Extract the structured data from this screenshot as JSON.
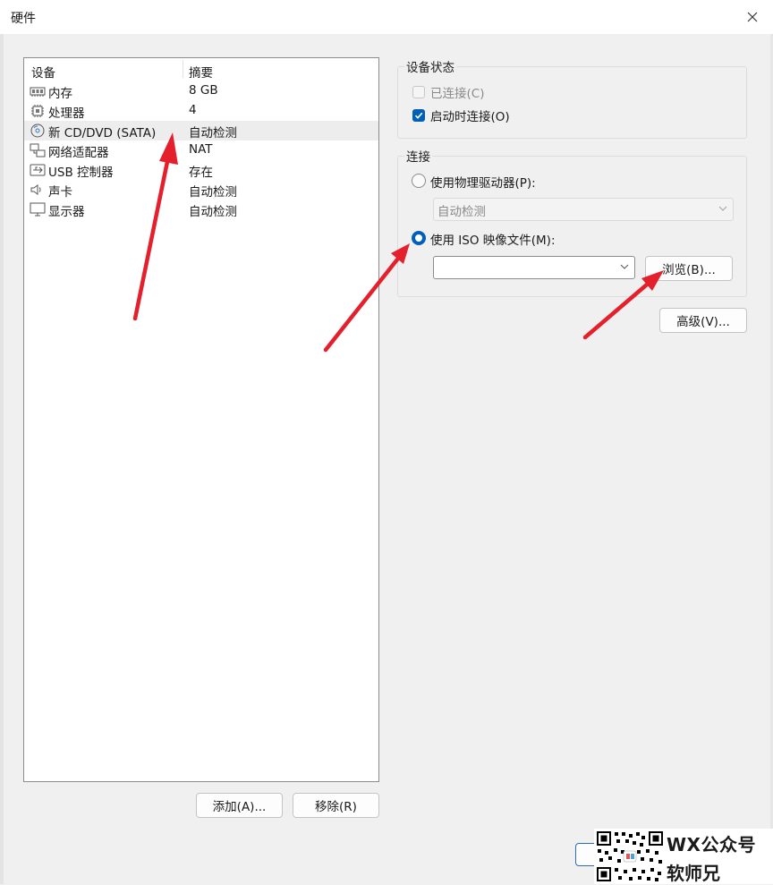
{
  "window": {
    "title": "硬件"
  },
  "device_list": {
    "headers": {
      "device": "设备",
      "summary": "摘要"
    },
    "items": [
      {
        "name": "内存",
        "summary": "8 GB",
        "icon": "memory-icon"
      },
      {
        "name": "处理器",
        "summary": "4",
        "icon": "processor-icon"
      },
      {
        "name": "新 CD/DVD (SATA)",
        "summary": "自动检测",
        "icon": "cd-dvd-icon"
      },
      {
        "name": "网络适配器",
        "summary": "NAT",
        "icon": "network-icon"
      },
      {
        "name": "USB 控制器",
        "summary": "存在",
        "icon": "usb-icon"
      },
      {
        "name": "声卡",
        "summary": "自动检测",
        "icon": "speaker-icon"
      },
      {
        "name": "显示器",
        "summary": "自动检测",
        "icon": "monitor-icon"
      }
    ],
    "selected_index": 2
  },
  "list_buttons": {
    "add": "添加(A)...",
    "remove": "移除(R)"
  },
  "device_status": {
    "title": "设备状态",
    "connected_label": "已连接(C)",
    "connect_on_power_on_label": "启动时连接(O)"
  },
  "connection": {
    "title": "连接",
    "physical_drive_label": "使用物理驱动器(P):",
    "physical_drive_value": "自动检测",
    "iso_label": "使用 ISO 映像文件(M):",
    "iso_value": "",
    "browse_label": "浏览(B)..."
  },
  "advanced_label": "高级(V)...",
  "watermark": {
    "line1": "WX公众号",
    "line2": "软师兄"
  },
  "colors": {
    "accent": "#005fb8",
    "annotation_arrow": "#e3202b"
  }
}
